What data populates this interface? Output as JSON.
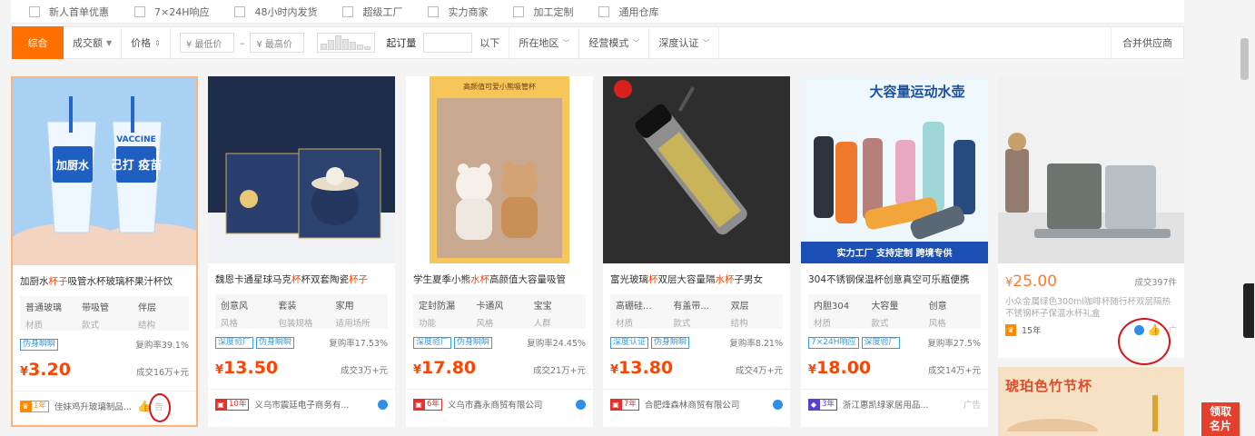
{
  "filters": [
    "新人首单优惠",
    "7×24H响应",
    "48小时内发货",
    "超级工厂",
    "实力商家",
    "加工定制",
    "通用仓库"
  ],
  "toolbar": {
    "active": "综合",
    "sort_items": [
      "成交额",
      "价格"
    ],
    "price_min_placeholder": "¥ 最低价",
    "price_max_placeholder": "¥ 最高价",
    "dash": "–",
    "qty_label": "起订量",
    "qty_suffix": "以下",
    "dropdowns": [
      "所在地区",
      "经营模式",
      "深度认证"
    ],
    "merge": "合并供应商"
  },
  "products": [
    {
      "title_pre": "加厨水",
      "title_hl": "杯子",
      "title_post": "吸管水杯玻璃杯果汁杯饮",
      "attrs": [
        {
          "v": "普通玻璃",
          "k": "材质"
        },
        {
          "v": "带吸管",
          "k": "款式"
        },
        {
          "v": "伴层",
          "k": "结构"
        }
      ],
      "tags": [
        "伪身瞬瞬"
      ],
      "rebuy": "复购率39.1%",
      "price": "3.20",
      "currency": "¥",
      "deal": "成交16万+元",
      "years": "1年",
      "company": "佳妹鸡升玻璃制品...",
      "ad": "告"
    },
    {
      "title_pre": "魏恩卡通星球马克",
      "title_hl": "杯",
      "title_post": "杯双套陶瓷",
      "title_hl2": "杯子",
      "attrs": [
        {
          "v": "创意风",
          "k": "风格"
        },
        {
          "v": "套装",
          "k": "包装规格"
        },
        {
          "v": "家用",
          "k": "适用场所"
        }
      ],
      "tags": [
        "深度验厂",
        "伪身瞬瞬"
      ],
      "rebuy": "复购率17.53%",
      "price": "13.50",
      "currency": "¥",
      "deal": "成交3万+元",
      "years": "10年",
      "company": "义乌市震廷电子商务有..."
    },
    {
      "title_pre": "学生夏季小熊",
      "title_hl": "水杯",
      "title_post": "高颜值大容量吸管",
      "attrs": [
        {
          "v": "定封防漏",
          "k": "功能"
        },
        {
          "v": "卡通风",
          "k": "风格"
        },
        {
          "v": "宝宝",
          "k": "人群"
        }
      ],
      "tags": [
        "深度验厂",
        "伪身瞬瞬"
      ],
      "rebuy": "复购率24.45%",
      "price": "17.80",
      "currency": "¥",
      "deal": "成交21万+元",
      "years": "6年",
      "company": "义乌市鑫永商贸有限公司"
    },
    {
      "title_pre": "富光玻璃",
      "title_hl": "杯",
      "title_post": "双层大容量隔",
      "title_hl2": "水杯",
      "title_post2": "子男女",
      "attrs": [
        {
          "v": "高硼硅...",
          "k": "材质"
        },
        {
          "v": "有盖带...",
          "k": "款式"
        },
        {
          "v": "双层",
          "k": "结构"
        }
      ],
      "tags": [
        "深度认证",
        "伪身瞬瞬"
      ],
      "rebuy": "复购率8.21%",
      "price": "13.80",
      "currency": "¥",
      "deal": "成交4万+元",
      "years": "7年",
      "company": "合肥烽森林商贸有限公司"
    },
    {
      "title_pre": "304不锈钢保温杯创意真空可乐瓶便携",
      "title_hl": "",
      "title_post": "",
      "attrs": [
        {
          "v": "内胆304",
          "k": "材质"
        },
        {
          "v": "大容量",
          "k": "款式"
        },
        {
          "v": "创意",
          "k": "风格"
        }
      ],
      "tags": [
        "7×24H响应",
        "深度验厂"
      ],
      "rebuy": "复购率27.5%",
      "price": "18.00",
      "currency": "¥",
      "deal": "成交14万+元",
      "years": "3年",
      "company": "浙江惠凯绿家居用品...",
      "ad": "广告"
    }
  ],
  "product6": {
    "price": "25.00",
    "currency": "¥",
    "deal": "成交397件",
    "title": "小众金属绿色300ml咖啡杯随行杯双层隔热不锈钢杯子保温水杯礼盒",
    "years": "15年",
    "ad": "广"
  },
  "product7": {
    "banner": "琥珀色竹节杯"
  },
  "image_texts": {
    "cup1_a": "加厨水",
    "cup1_b": "己打\n疫苗",
    "cup1_c": "VACCINE",
    "p5_banner": "大容量运动水壶",
    "p5_footer": "实力工厂 支持定制 跨境专供",
    "p3_top": "高颜值可爱小熊吸管杯"
  },
  "side_button": [
    "领取",
    "名片"
  ],
  "colors": {
    "accent": "#ff7000",
    "price": "#ff4400",
    "tag": "#3a9bdc",
    "annotation": "#d4151b"
  }
}
